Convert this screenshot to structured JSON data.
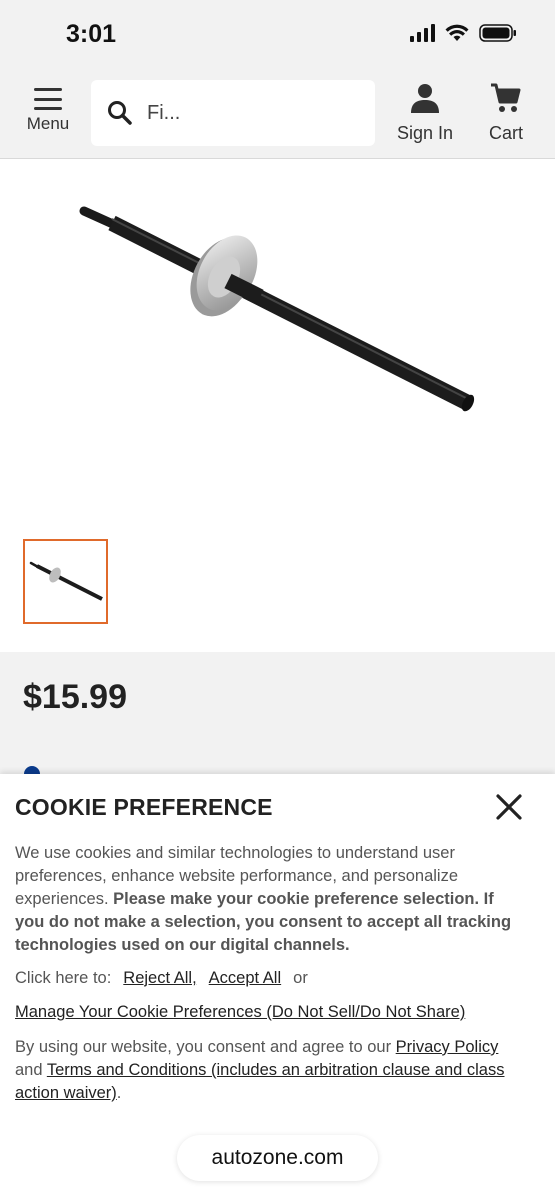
{
  "status_bar": {
    "time": "3:01"
  },
  "header": {
    "menu_label": "Menu",
    "search_placeholder": "Fi...",
    "signin_label": "Sign In",
    "cart_label": "Cart"
  },
  "product": {
    "price": "$15.99"
  },
  "cookie_banner": {
    "title": "COOKIE PREFERENCE",
    "body_intro": "We use cookies and similar technologies to understand user preferences, enhance website performance, and personalize experiences.",
    "body_bold": "Please make your cookie preference selection. If you do not make a selection, you consent to accept all tracking technologies used on our digital channels.",
    "click_here": "Click here to:",
    "reject_all": "Reject All,",
    "accept_all": "Accept All",
    "or": "or",
    "manage": "Manage Your Cookie Preferences (Do Not Sell/Do Not Share)",
    "consent_prefix": "By using our website, you consent and agree to our",
    "privacy_policy": "Privacy Policy",
    "and": "and",
    "terms": "Terms and Conditions (includes an arbitration clause and class action waiver)",
    "period": "."
  },
  "browser": {
    "domain": "autozone.com"
  },
  "colors": {
    "thumbnail_border": "#e06a2b",
    "background_gray": "#f2f2f2"
  }
}
